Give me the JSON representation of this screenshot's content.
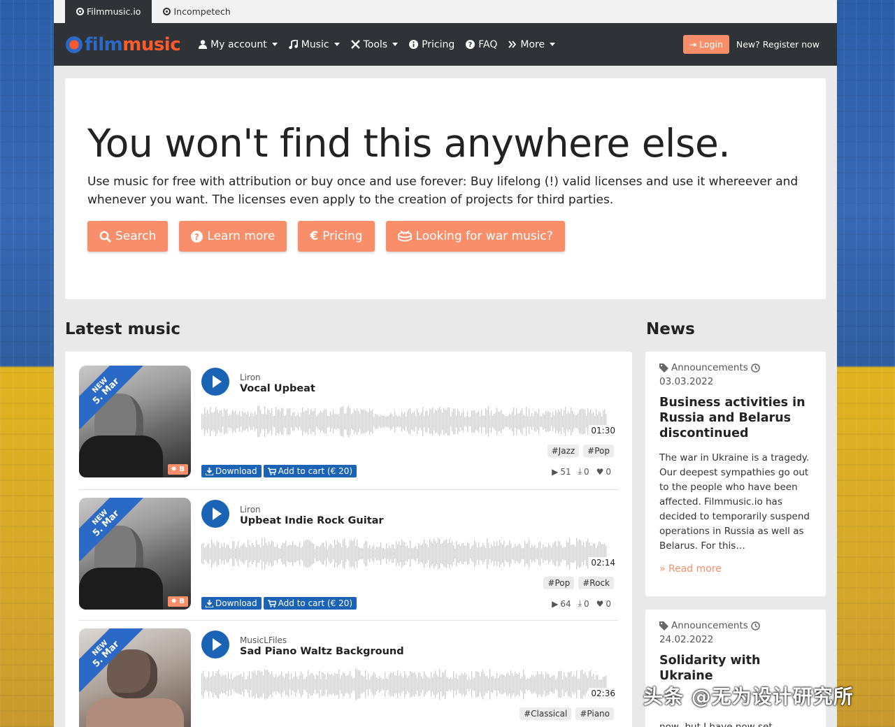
{
  "tabs": [
    {
      "label": "Filmmusic.io",
      "active": true
    },
    {
      "label": "Incompetech",
      "active": false
    }
  ],
  "logo": {
    "part1": "film",
    "part2": "music"
  },
  "nav": {
    "my_account": "My account",
    "music": "Music",
    "tools": "Tools",
    "pricing": "Pricing",
    "faq": "FAQ",
    "more": "More",
    "login": "Login",
    "register": "New? Register now"
  },
  "hero": {
    "heading": "You won't find this anywhere else.",
    "text": "Use music for free with attribution or buy once and use forever: Buy lifelong (!) valid licenses and use it whereever and whenever you want. The licenses even apply to the creation of projects for third parties.",
    "buttons": {
      "search": "Search",
      "learn_more": "Learn more",
      "pricing": "Pricing",
      "war_music": "Looking for war music?"
    }
  },
  "latest": {
    "title": "Latest music",
    "tracks": [
      {
        "ribbon_new": "NEW",
        "ribbon_date": "5. Mar",
        "badge": "B",
        "artist": "Liron",
        "title": "Vocal Upbeat",
        "duration": "01:30",
        "tags": [
          "#Jazz",
          "#Pop"
        ],
        "download": "Download",
        "cart": "Add to cart (€ 20)",
        "plays": "51",
        "downloads": "0",
        "likes": "0"
      },
      {
        "ribbon_new": "NEW",
        "ribbon_date": "5. Mar",
        "badge": "B",
        "artist": "Liron",
        "title": "Upbeat Indie Rock Guitar",
        "duration": "02:14",
        "tags": [
          "#Pop",
          "#Rock"
        ],
        "download": "Download",
        "cart": "Add to cart (€ 20)",
        "plays": "64",
        "downloads": "0",
        "likes": "0"
      },
      {
        "ribbon_new": "NEW",
        "ribbon_date": "5. Mar",
        "artist": "MusicLFiles",
        "title": "Sad Piano Waltz Background",
        "duration": "02:36",
        "tags": [
          "#Classical",
          "#Piano"
        ]
      }
    ]
  },
  "news": {
    "title": "News",
    "items": [
      {
        "category": "Announcements",
        "date": "03.03.2022",
        "title": "Business activities in Russia and Belarus discontinued",
        "text": "The war in Ukraine is a tragedy. Our deepest sympathies go out to the people who have been affected. Filmmusic.io has decided to temporarily suspend operations in Russia as well as Belarus. For this…",
        "read_more": "Read more"
      },
      {
        "category": "Announcements",
        "date": "24.02.2022",
        "title": "Solidarity with Ukraine",
        "text": "now, but I have now set"
      }
    ]
  },
  "watermark": "头条 @无为设计研究所",
  "colors": {
    "accent": "#f98e6a",
    "primary": "#1b63b5",
    "nav_bg": "#2f3337"
  }
}
